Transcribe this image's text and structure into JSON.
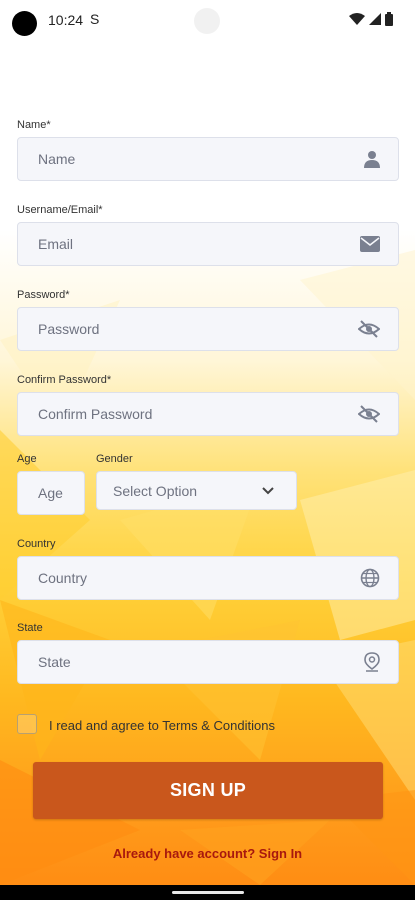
{
  "status": {
    "time": "10:24",
    "s_icon": "S"
  },
  "form": {
    "name": {
      "label": "Name*",
      "placeholder": "Name",
      "icon": "person-icon"
    },
    "email": {
      "label": "Username/Email*",
      "placeholder": "Email",
      "icon": "mail-icon"
    },
    "password": {
      "label": "Password*",
      "placeholder": "Password",
      "icon": "eye-off-icon"
    },
    "confirm_password": {
      "label": "Confirm Password*",
      "placeholder": "Confirm Password",
      "icon": "eye-off-icon"
    },
    "age": {
      "label": "Age",
      "placeholder": "Age"
    },
    "gender": {
      "label": "Gender",
      "value": "Select Option",
      "icon": "chevron-down-icon"
    },
    "country": {
      "label": "Country",
      "placeholder": "Country",
      "icon": "globe-icon"
    },
    "state": {
      "label": "State",
      "placeholder": "State",
      "icon": "map-pin-icon"
    },
    "terms": {
      "text": "I read and agree to Terms & Conditions"
    },
    "signup_button": "SIGN UP",
    "signin_link": "Already have account? Sign In"
  },
  "colors": {
    "button": "#c9571c",
    "signin_text": "#a8180e",
    "field_bg": "#f5f6fa",
    "icon": "#7a8090"
  }
}
